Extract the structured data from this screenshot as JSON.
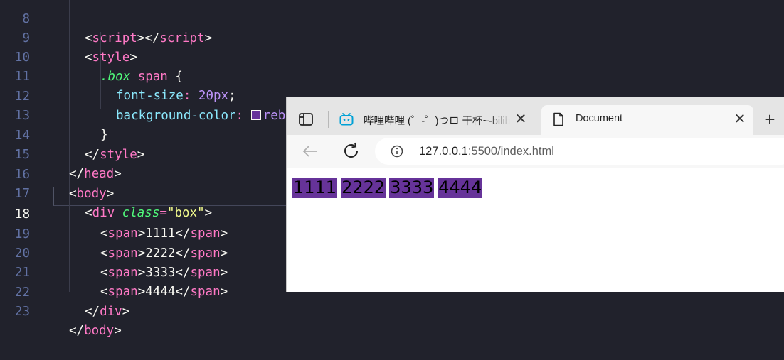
{
  "editor": {
    "line_numbers": [
      "8",
      "9",
      "10",
      "11",
      "12",
      "13",
      "14",
      "15",
      "16",
      "17",
      "18",
      "19",
      "20",
      "21",
      "22",
      "23"
    ],
    "active_line": "18",
    "code": {
      "l8": {
        "open": "<",
        "tag1": "script",
        "mid": "></",
        "tag2": "script",
        "close": ">"
      },
      "l9": {
        "open": "<",
        "tag": "style",
        "close": ">"
      },
      "l10": {
        "selector_class": ".box",
        "selector_tag": "span",
        "brace": " {"
      },
      "l11": {
        "property": "font-size",
        "colon": ": ",
        "value": "20px",
        "semi": ";"
      },
      "l12": {
        "property": "background-color",
        "colon": ": ",
        "value": "rebeccapurple",
        "semi": ";",
        "swatch_color": "#663399"
      },
      "l13": {
        "brace": "}"
      },
      "l14": {
        "open": "</",
        "tag": "style",
        "close": ">"
      },
      "l15": {
        "open": "</",
        "tag": "head",
        "close": ">"
      },
      "l16": {
        "open": "<",
        "tag": "body",
        "close": ">"
      },
      "l17": {
        "open": "<",
        "tag": "div",
        "attr": "class",
        "eq": "=",
        "value": "\"box\"",
        "close": ">"
      },
      "l18": {
        "open": "<",
        "tag1": "span",
        "mid1": ">",
        "text": "1111",
        "mid2": "</",
        "tag2": "span",
        "close": ">"
      },
      "l19": {
        "open": "<",
        "tag1": "span",
        "mid1": ">",
        "text": "2222",
        "mid2": "</",
        "tag2": "span",
        "close": ">"
      },
      "l20": {
        "open": "<",
        "tag1": "span",
        "mid1": ">",
        "text": "3333",
        "mid2": "</",
        "tag2": "span",
        "close": ">"
      },
      "l21": {
        "open": "<",
        "tag1": "span",
        "mid1": ">",
        "text": "4444",
        "mid2": "</",
        "tag2": "span",
        "close": ">"
      },
      "l22": {
        "open": "</",
        "tag": "div",
        "close": ">"
      },
      "l23": {
        "open": "</",
        "tag": "body",
        "close": ">"
      }
    }
  },
  "browser": {
    "tabs": [
      {
        "title": "哔哩哔哩 (゜-゜)つロ 干杯~-bilibili",
        "icon": "bilibili-icon",
        "active": false,
        "close_label": "✕"
      },
      {
        "title": "Document",
        "icon": "document-icon",
        "active": true,
        "close_label": "✕"
      }
    ],
    "new_tab_label": "+",
    "url_host": "127.0.0.1",
    "url_rest": ":5500/index.html",
    "page_spans": [
      "1111",
      "2222",
      "3333",
      "4444"
    ],
    "span_background": "#663399"
  }
}
